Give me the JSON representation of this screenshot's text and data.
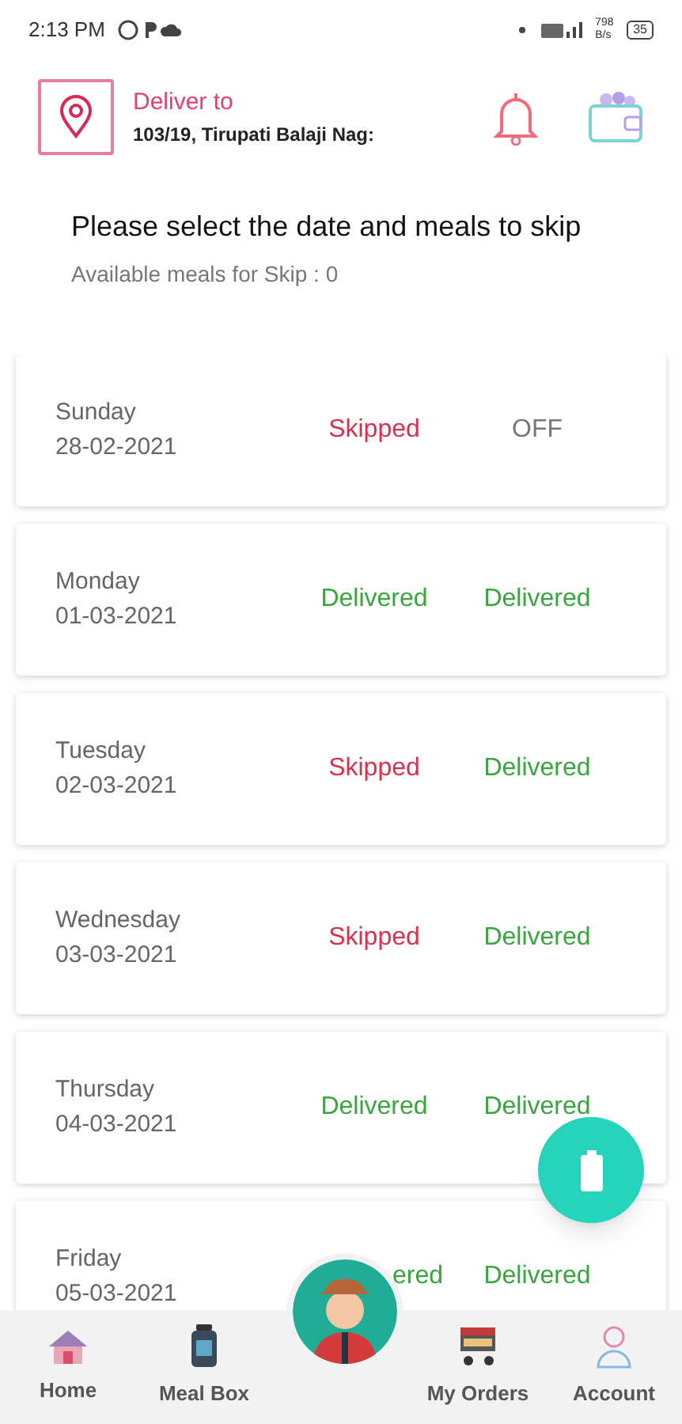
{
  "status_bar": {
    "time": "2:13 PM",
    "network_speed": "798 B/s",
    "battery": "35"
  },
  "header": {
    "label": "Deliver to",
    "address": "103/19, Tirupati Balaji Nag:"
  },
  "title": "Please select the date and meals to skip",
  "subtitle": "Available meals for Skip : 0",
  "days": [
    {
      "day": "Sunday",
      "date": "28-02-2021",
      "meals": [
        {
          "kind": "skipped",
          "text": "Skipped"
        },
        {
          "kind": "off",
          "text": "OFF"
        }
      ]
    },
    {
      "day": "Monday",
      "date": "01-03-2021",
      "meals": [
        {
          "kind": "delivered",
          "text": "Delivered"
        },
        {
          "kind": "delivered",
          "text": "Delivered"
        }
      ]
    },
    {
      "day": "Tuesday",
      "date": "02-03-2021",
      "meals": [
        {
          "kind": "skipped",
          "text": "Skipped"
        },
        {
          "kind": "delivered",
          "text": "Delivered"
        }
      ]
    },
    {
      "day": "Wednesday",
      "date": "03-03-2021",
      "meals": [
        {
          "kind": "skipped",
          "text": "Skipped"
        },
        {
          "kind": "delivered",
          "text": "Delivered"
        }
      ]
    },
    {
      "day": "Thursday",
      "date": "04-03-2021",
      "meals": [
        {
          "kind": "delivered",
          "text": "Delivered"
        },
        {
          "kind": "delivered",
          "text": "Delivered"
        }
      ]
    },
    {
      "day": "Friday",
      "date": "05-03-2021",
      "meals": [
        {
          "kind": "delivered",
          "text": "ered"
        },
        {
          "kind": "delivered",
          "text": "Delivered"
        }
      ]
    }
  ],
  "bottom_nav": [
    {
      "label": "Home",
      "kind": "home"
    },
    {
      "label": "Meal Box",
      "kind": "box"
    },
    {
      "kind": "avatar"
    },
    {
      "label": "My Orders",
      "kind": "cart"
    },
    {
      "label": "Account",
      "kind": "account"
    }
  ]
}
